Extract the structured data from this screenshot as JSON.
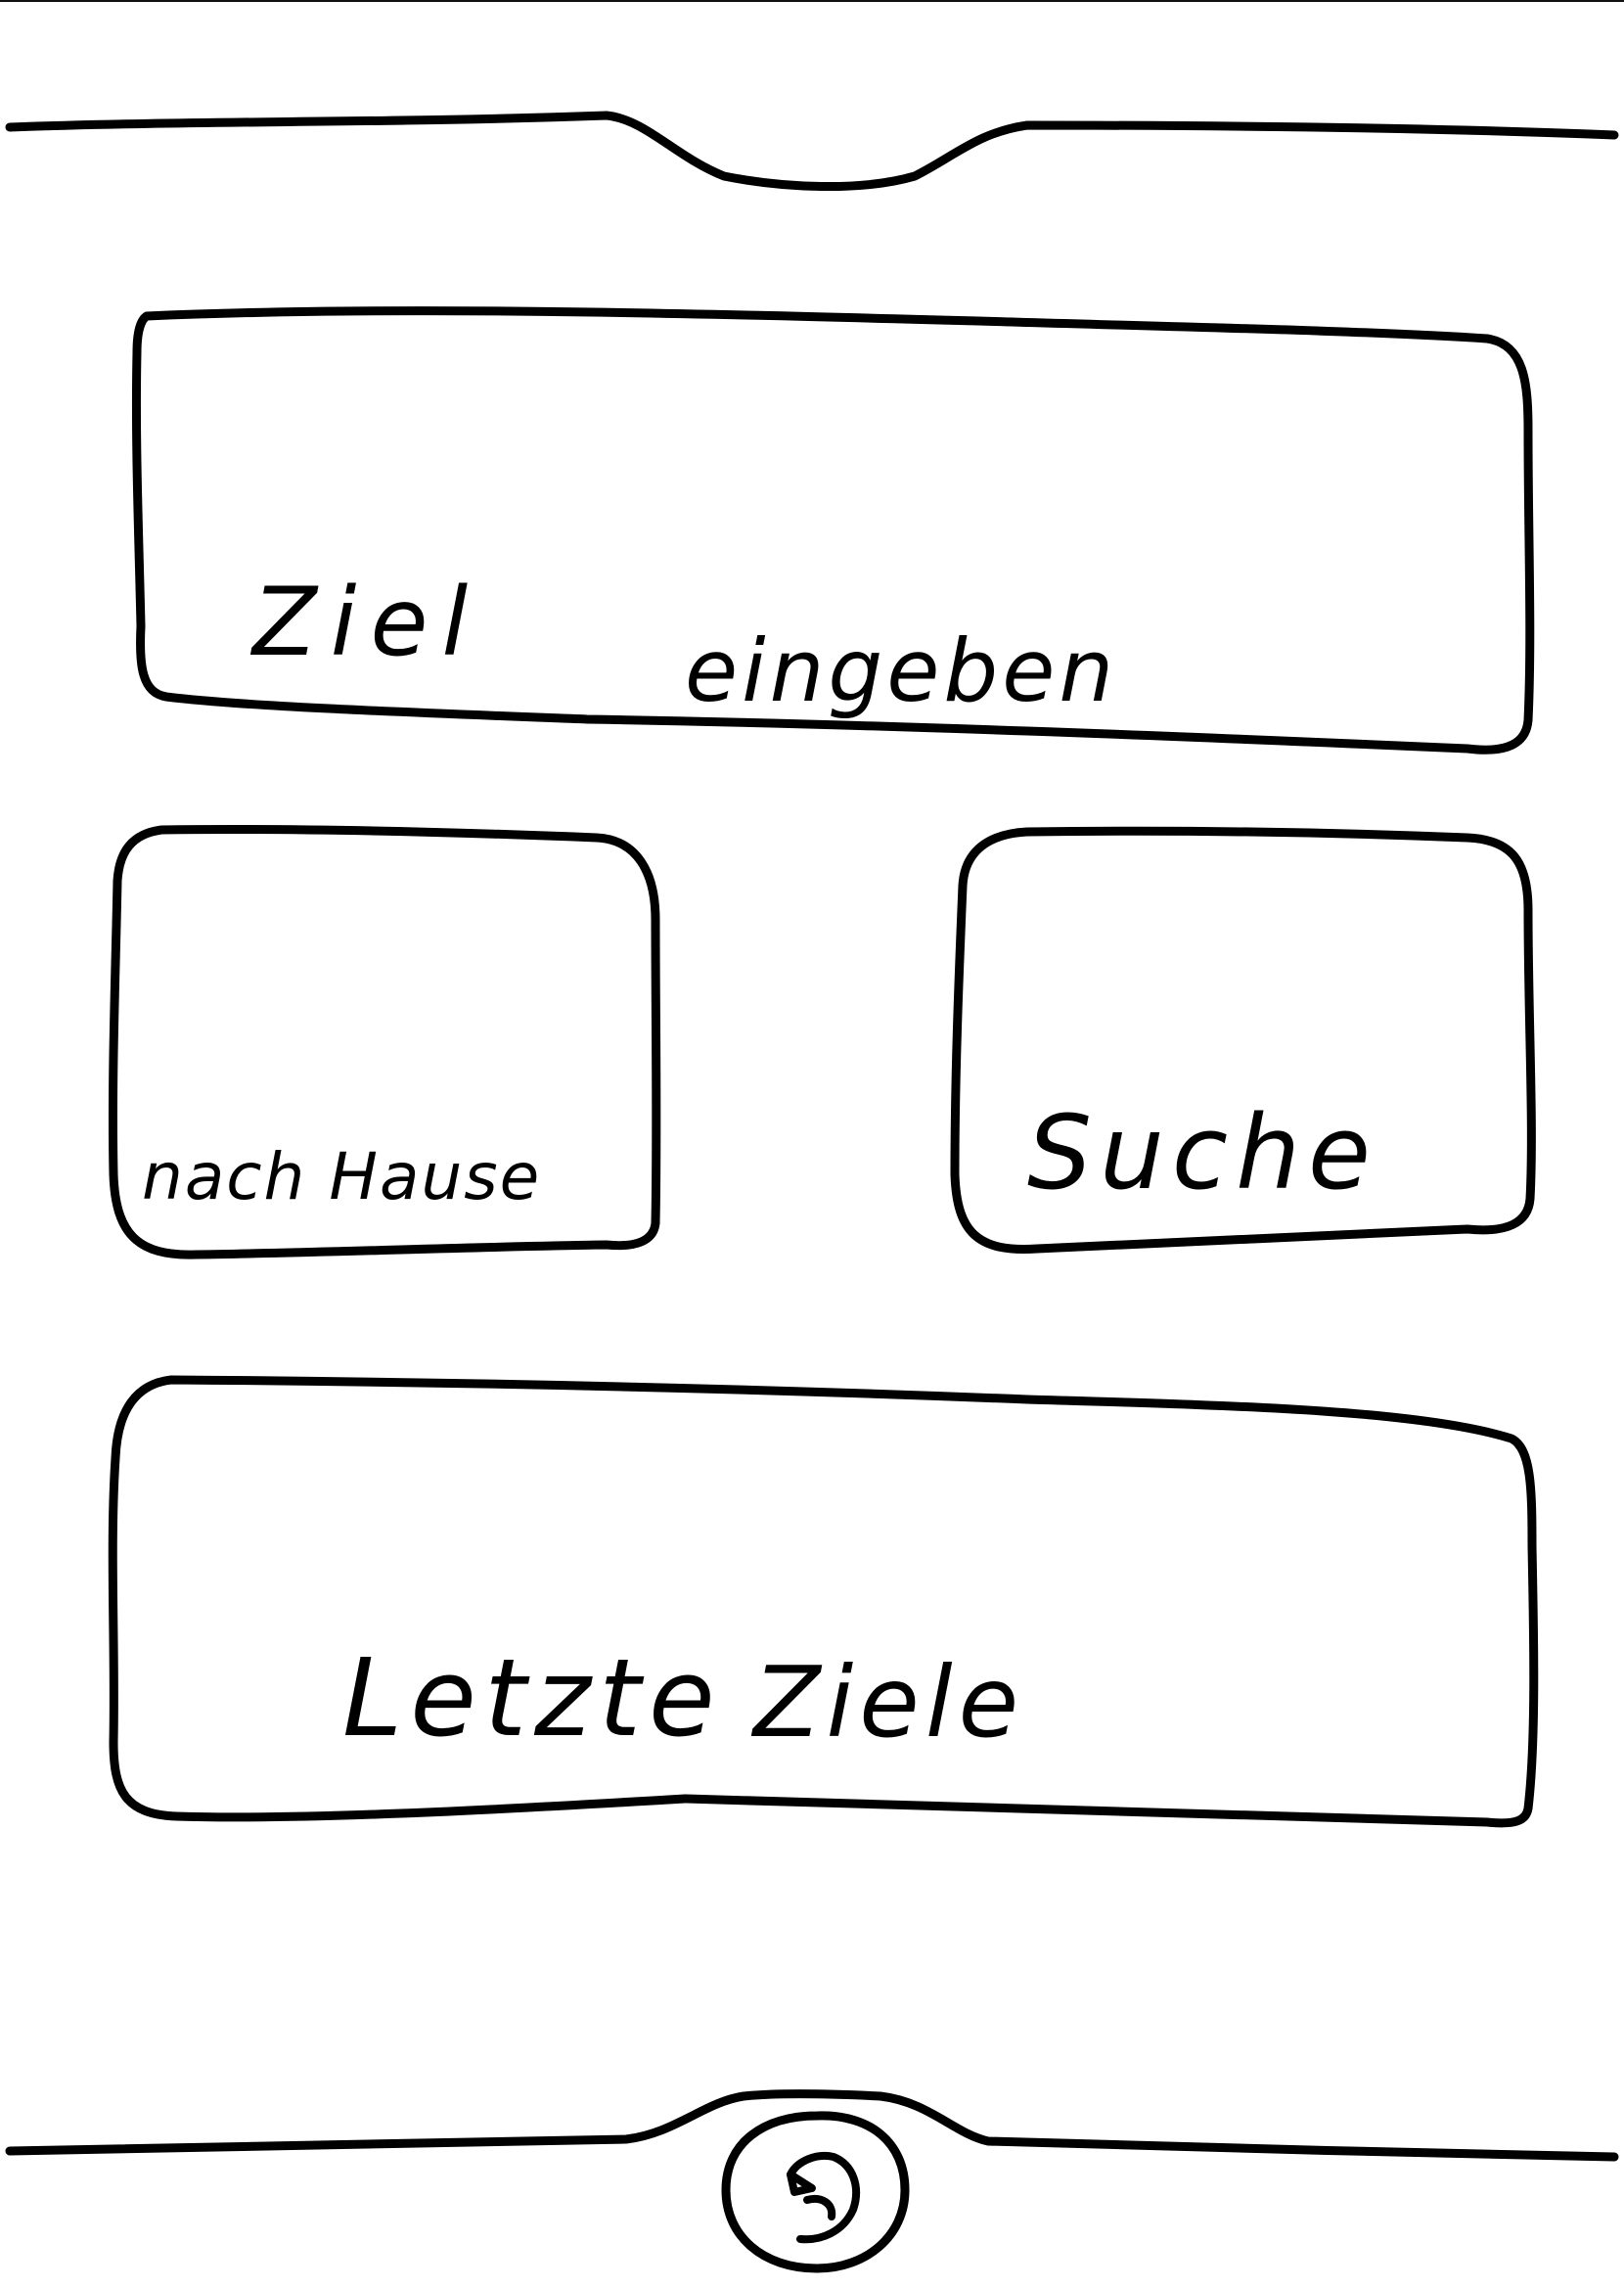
{
  "destination_input": {
    "placeholder_line1": "Ziel",
    "placeholder_line2": "eingeben"
  },
  "home_button": {
    "label": "nach Hause"
  },
  "search_button": {
    "label": "Suche"
  },
  "recent_destinations": {
    "label_part1": "Letzte",
    "label_part2": "Ziele"
  },
  "bottom_bar": {
    "back_icon": "back-arrow-icon"
  }
}
